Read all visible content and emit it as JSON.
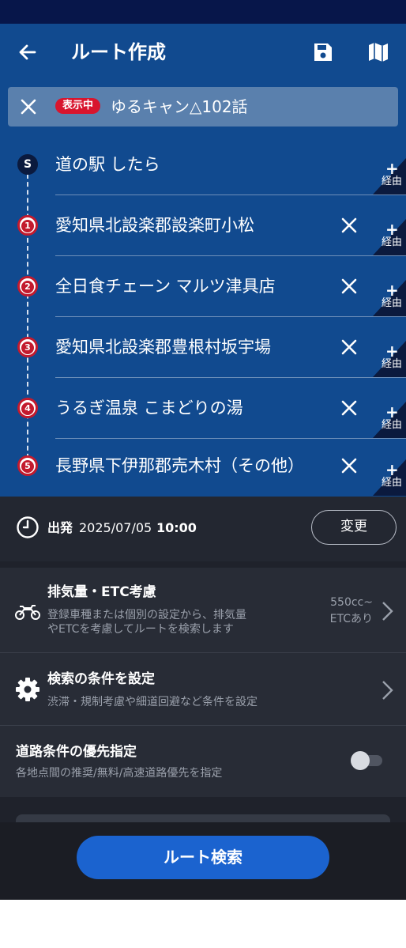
{
  "header": {
    "title": "ルート作成"
  },
  "active_route": {
    "badge": "表示中",
    "name": "ゆるキャン△102話"
  },
  "waypoints": [
    {
      "marker": "S",
      "label": "道の駅 したら"
    },
    {
      "marker": "1",
      "label": "愛知県北設楽郡設楽町小松"
    },
    {
      "marker": "2",
      "label": "全日食チェーン マルツ津具店"
    },
    {
      "marker": "3",
      "label": "愛知県北設楽郡豊根村坂宇場"
    },
    {
      "marker": "4",
      "label": "うるぎ温泉 こまどりの湯"
    },
    {
      "marker": "5",
      "label": "長野県下伊那郡売木村（その他）"
    }
  ],
  "via_label": "経由",
  "departure": {
    "label": "出発",
    "date": "2025/07/05",
    "time": "10:00",
    "change_label": "変更"
  },
  "settings": {
    "vehicle": {
      "title": "排気量・ETC考慮",
      "desc_line1": "登録車種または個別の設定から、排気量",
      "desc_line2": "やETCを考慮してルートを検索します",
      "value_line1": "550cc~",
      "value_line2": "ETCあり"
    },
    "conditions": {
      "title": "検索の条件を設定",
      "desc": "渋滞・規制考慮や細道回避など条件を設定"
    },
    "road_priority": {
      "title": "道路条件の優先指定",
      "desc": "各地点間の推奨/無料/高速道路優先を指定",
      "enabled": false
    }
  },
  "footer": {
    "search_label": "ルート検索"
  },
  "colors": {
    "header_bg": "#114a8f",
    "marker_red": "#c31a2d",
    "badge_red": "#d8152e",
    "primary_button": "#1b63cf",
    "panel_bg": "#282c36"
  }
}
